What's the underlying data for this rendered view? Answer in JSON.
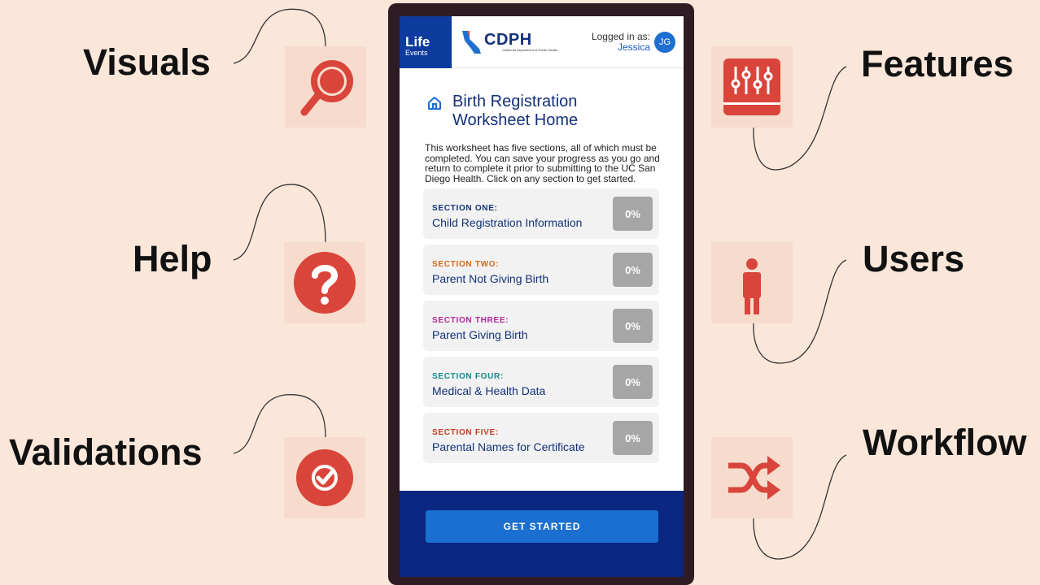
{
  "labels": {
    "visuals": "Visuals",
    "help": "Help",
    "validations": "Validations",
    "features": "Features",
    "users": "Users",
    "workflow": "Workflow"
  },
  "icons": {
    "visuals": "magnifier-icon",
    "help": "question-icon",
    "validations": "check-circle-icon",
    "features": "sliders-icon",
    "users": "person-icon",
    "workflow": "shuffle-icon"
  },
  "colors": {
    "background": "#fbe7da",
    "accent_red": "#d9453a",
    "brand_navy": "#0d3b9e",
    "button_blue": "#1a6fd0"
  },
  "app": {
    "brand_life": "Life",
    "brand_events": "Events",
    "cdph": "CDPH",
    "cdph_sub": "California Department of Public Health",
    "logged_in_label": "Logged in as:",
    "user_name": "Jessica",
    "avatar_initials": "JG",
    "title": "Birth Registration Worksheet Home",
    "description": "This worksheet has five sections, all of which must be completed. You can save your progress as you go and return to complete it prior to submitting to the UC San Diego Health. Click on any section to get started.",
    "sections": [
      {
        "label": "SECTION ONE:",
        "name": "Child Registration Information",
        "percent": "0%",
        "color": "#13307a"
      },
      {
        "label": "SECTION TWO:",
        "name": "Parent Not Giving Birth",
        "percent": "0%",
        "color": "#d46a1c"
      },
      {
        "label": "SECTION THREE:",
        "name": "Parent Giving Birth",
        "percent": "0%",
        "color": "#b02a9a"
      },
      {
        "label": "SECTION FOUR:",
        "name": "Medical & Health Data",
        "percent": "0%",
        "color": "#138a8a"
      },
      {
        "label": "SECTION FIVE:",
        "name": "Parental Names for Certificate",
        "percent": "0%",
        "color": "#c4401f"
      }
    ],
    "cta": "GET STARTED"
  }
}
